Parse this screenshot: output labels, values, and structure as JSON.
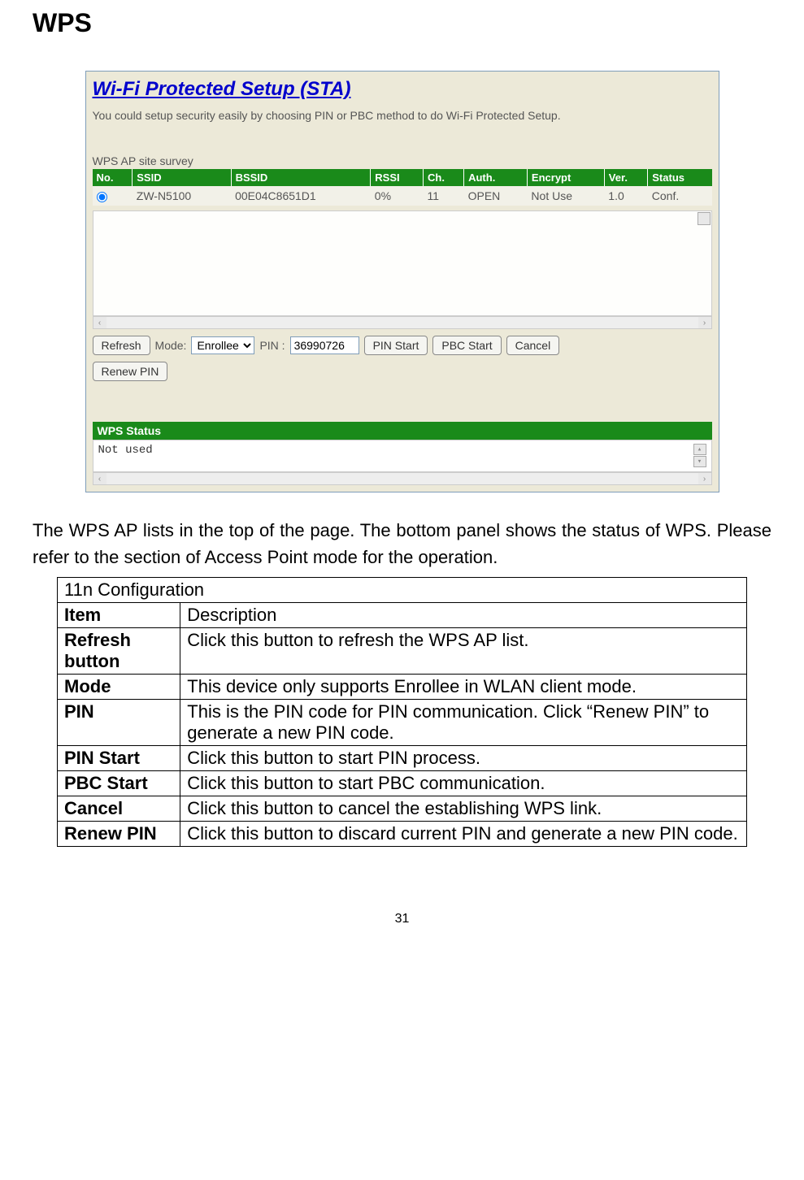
{
  "page_title": "WPS",
  "panel": {
    "title": "Wi-Fi Protected Setup (STA)",
    "description": "You could setup security easily by choosing PIN or PBC method to do Wi-Fi Protected Setup.",
    "survey_label": "WPS AP site survey",
    "headers": [
      "No.",
      "SSID",
      "BSSID",
      "RSSI",
      "Ch.",
      "Auth.",
      "Encrypt",
      "Ver.",
      "Status"
    ],
    "rows": [
      {
        "ssid": "ZW-N5100",
        "bssid": "00E04C8651D1",
        "rssi": "0%",
        "ch": "11",
        "auth": "OPEN",
        "encrypt": "Not Use",
        "ver": "1.0",
        "status": "Conf."
      }
    ],
    "buttons": {
      "refresh": "Refresh",
      "pin_start": "PIN Start",
      "pbc_start": "PBC Start",
      "cancel": "Cancel",
      "renew_pin": "Renew PIN"
    },
    "mode_label": "Mode:",
    "mode_value": "Enrollee",
    "pin_label": "PIN :",
    "pin_value": "36990726",
    "status_header": "WPS Status",
    "status_text": "Not used"
  },
  "body_paragraph": "The WPS AP lists in the top of the page. The bottom panel shows the status of WPS. Please refer to the section of Access Point mode for the operation.",
  "config_table": {
    "section": "11n Configuration",
    "col1": "Item",
    "col2": "Description",
    "rows": [
      {
        "item": "Refresh button",
        "desc": "Click this button to refresh the WPS AP list."
      },
      {
        "item": "Mode",
        "desc": "This device only supports Enrollee in WLAN client mode."
      },
      {
        "item": "PIN",
        "desc": "This is the PIN code for PIN communication. Click “Renew PIN” to generate a new PIN code."
      },
      {
        "item": "PIN Start",
        "desc": "Click this button to start PIN process."
      },
      {
        "item": "PBC Start",
        "desc": "Click this button to start PBC communication."
      },
      {
        "item": "Cancel",
        "desc": "Click this button to cancel the establishing WPS link."
      },
      {
        "item": "Renew PIN",
        "desc": "Click this button to discard current PIN and generate a new PIN code."
      }
    ]
  },
  "page_number": "31"
}
